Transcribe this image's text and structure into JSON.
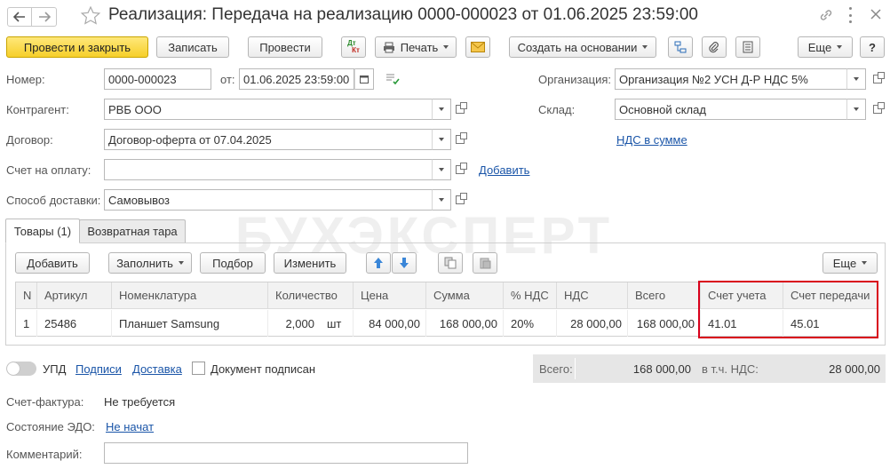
{
  "window": {
    "title": "Реализация: Передача на реализацию 0000-000023 от 01.06.2025 23:59:00"
  },
  "toolbar": {
    "post_close": "Провести и закрыть",
    "save": "Записать",
    "post": "Провести",
    "dt_kt_top": "Дт",
    "dt_kt_bottom": "Кт",
    "print": "Печать",
    "create_based": "Создать на основании",
    "more": "Еще",
    "help": "?"
  },
  "form": {
    "number_label": "Номер:",
    "number_value": "0000-000023",
    "date_label": "от:",
    "date_value": "01.06.2025 23:59:00",
    "org_label": "Организация:",
    "org_value": "Организация №2 УСН Д-Р НДС 5%",
    "counterparty_label": "Контрагент:",
    "counterparty_value": "РВБ ООО",
    "warehouse_label": "Склад:",
    "warehouse_value": "Основной склад",
    "contract_label": "Договор:",
    "contract_value": "Договор-оферта от 07.04.2025",
    "vat_link": "НДС в сумме",
    "invoice_label": "Счет на оплату:",
    "invoice_value": "",
    "invoice_add": "Добавить",
    "delivery_label": "Способ доставки:",
    "delivery_value": "Самовывоз"
  },
  "watermark": "БУХЭКСПЕРТ",
  "tabs": [
    {
      "label": "Товары (1)"
    },
    {
      "label": "Возвратная тара"
    }
  ],
  "table_toolbar": {
    "add": "Добавить",
    "fill": "Заполнить",
    "select": "Подбор",
    "edit": "Изменить",
    "more": "Еще"
  },
  "table": {
    "columns": [
      "N",
      "Артикул",
      "Номенклатура",
      "Количество",
      "Цена",
      "Сумма",
      "% НДС",
      "НДС",
      "Всего",
      "Счет учета",
      "Счет передачи"
    ],
    "rows": [
      {
        "n": "1",
        "article": "25486",
        "item": "Планшет Samsung",
        "qty": "2,000",
        "unit": "шт",
        "price": "84 000,00",
        "sum": "168 000,00",
        "vat_rate": "20%",
        "vat": "28 000,00",
        "total": "168 000,00",
        "account": "41.01",
        "transfer_account": "45.01"
      }
    ]
  },
  "footer": {
    "upd_label": "УПД",
    "signatures_link": "Подписи",
    "delivery_link": "Доставка",
    "signed_label": "Документ подписан",
    "total_label": "Всего:",
    "total_value": "168 000,00",
    "vat_label": "в т.ч. НДС:",
    "vat_value": "28 000,00",
    "invoice_label": "Счет-фактура:",
    "invoice_value": "Не требуется",
    "edo_label": "Состояние ЭДО:",
    "edo_link": "Не начат",
    "comment_label": "Комментарий:",
    "comment_value": ""
  },
  "colors": {
    "primary_button": "#f6cf2a",
    "link": "#1a55a8",
    "highlight_frame": "#d9001b",
    "arrow_blue": "#3a86d8"
  }
}
